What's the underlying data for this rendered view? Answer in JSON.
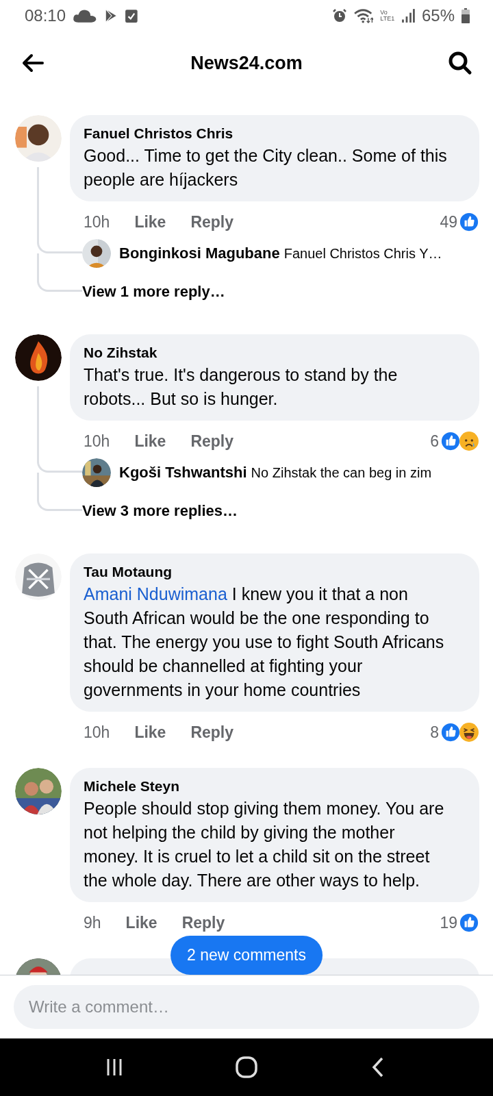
{
  "status_bar": {
    "time": "08:10",
    "network_label": [
      "Vo",
      "LTE1"
    ],
    "battery": "65%"
  },
  "header": {
    "title": "News24.com"
  },
  "comments": [
    {
      "author": "Fanuel Christos Chris",
      "text": "Good... Time to get the City clean.. Some of this people are híjackers",
      "time": "10h",
      "like": "Like",
      "reply": "Reply",
      "count": "49",
      "reactions": [
        {
          "kind": "like"
        }
      ],
      "replies": [
        {
          "author": "Bonginkosi Magubane",
          "text": "Fanuel Christos Chris Y…"
        }
      ],
      "more": "View 1 more reply…"
    },
    {
      "author": "No Zihstak",
      "text": "That's true. It's dangerous to stand by the robots... But so is hunger.",
      "time": "10h",
      "like": "Like",
      "reply": "Reply",
      "count": "6",
      "reactions": [
        {
          "kind": "like"
        },
        {
          "kind": "sad"
        }
      ],
      "replies": [
        {
          "author": "Kgoši Tshwantshi",
          "text": "No Zihstak the can beg in zim"
        }
      ],
      "more": "View 3 more replies…"
    },
    {
      "author": "Tau Motaung",
      "mention": "Amani Nduwimana",
      "text": "I knew you it that a non South African would be the one responding to that. The energy you use to fight South Africans should be channelled at fighting your governments in your home countries",
      "time": "10h",
      "like": "Like",
      "reply": "Reply",
      "count": "8",
      "reactions": [
        {
          "kind": "like"
        },
        {
          "kind": "haha"
        }
      ]
    },
    {
      "author": "Michele Steyn",
      "text": "People should stop giving them money. You are not helping the child by giving the mother money. It is cruel to let a child sit on the street the whole day. There are other ways to help.",
      "time": "9h",
      "like": "Like",
      "reply": "Reply",
      "count": "19",
      "reactions": [
        {
          "kind": "like"
        }
      ]
    }
  ],
  "new_comments": "2 new comments",
  "composer": {
    "placeholder": "Write a comment…"
  }
}
